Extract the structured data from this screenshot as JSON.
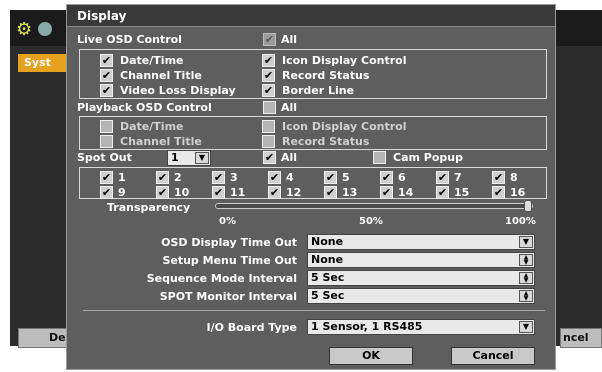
{
  "background_window": {
    "tab_label": "Syst",
    "left_button_label": "Defa",
    "right_button_label": "ncel",
    "accent_color": "#e8a11c"
  },
  "dialog": {
    "title": "Display",
    "live_osd": {
      "label": "Live OSD Control",
      "all_label": "All",
      "all_checked": true,
      "items": [
        {
          "label": "Date/Time",
          "checked": true
        },
        {
          "label": "Icon Display Control",
          "checked": true
        },
        {
          "label": "Channel Title",
          "checked": true
        },
        {
          "label": "Record Status",
          "checked": true
        },
        {
          "label": "Video Loss Display",
          "checked": true
        },
        {
          "label": "Border Line",
          "checked": true
        }
      ]
    },
    "playback_osd": {
      "label": "Playback OSD Control",
      "all_label": "All",
      "all_checked": false,
      "items": [
        {
          "label": "Date/Time",
          "checked": false
        },
        {
          "label": "Icon Display Control",
          "checked": false
        },
        {
          "label": "Channel Title",
          "checked": false
        },
        {
          "label": "Record Status",
          "checked": false
        }
      ]
    },
    "spot_out": {
      "label": "Spot Out",
      "value": "1",
      "all_label": "All",
      "all_checked": true,
      "cam_popup_label": "Cam Popup",
      "cam_popup_checked": false,
      "channels": [
        "1",
        "2",
        "3",
        "4",
        "5",
        "6",
        "7",
        "8",
        "9",
        "10",
        "11",
        "12",
        "13",
        "14",
        "15",
        "16"
      ]
    },
    "transparency": {
      "label": "Transparency",
      "min_label": "0%",
      "mid_label": "50%",
      "max_label": "100%",
      "value_fraction": 1.0
    },
    "settings": [
      {
        "label": "OSD Display Time Out",
        "value": "None",
        "control": "dropdown"
      },
      {
        "label": "Setup Menu Time Out",
        "value": "None",
        "control": "spinner"
      },
      {
        "label": "Sequence Mode Interval",
        "value": "5 Sec",
        "control": "spinner"
      },
      {
        "label": "SPOT Monitor Interval",
        "value": "5 Sec",
        "control": "spinner"
      }
    ],
    "io_board": {
      "label": "I/O Board Type",
      "value": "1 Sensor, 1 RS485"
    },
    "ok_label": "OK",
    "cancel_label": "Cancel"
  }
}
